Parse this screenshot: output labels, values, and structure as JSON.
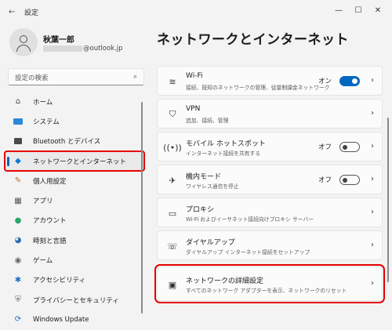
{
  "window": {
    "title": "設定",
    "minimize": "—",
    "maximize": "☐",
    "close": "✕"
  },
  "profile": {
    "name": "秋葉一郎",
    "email_suffix": "@outlook.jp"
  },
  "search": {
    "placeholder": "設定の検索"
  },
  "nav": {
    "items": [
      {
        "label": "ホーム",
        "icon": "home-icon"
      },
      {
        "label": "システム",
        "icon": "system-icon"
      },
      {
        "label": "Bluetooth とデバイス",
        "icon": "bluetooth-icon"
      },
      {
        "label": "ネットワークとインターネット",
        "icon": "wifi-icon",
        "active": true
      },
      {
        "label": "個人用設定",
        "icon": "brush-icon"
      },
      {
        "label": "アプリ",
        "icon": "apps-icon"
      },
      {
        "label": "アカウント",
        "icon": "account-icon"
      },
      {
        "label": "時刻と言語",
        "icon": "clock-globe-icon"
      },
      {
        "label": "ゲーム",
        "icon": "gamepad-icon"
      },
      {
        "label": "アクセシビリティ",
        "icon": "accessibility-icon"
      },
      {
        "label": "プライバシーとセキュリティ",
        "icon": "shield-icon"
      },
      {
        "label": "Windows Update",
        "icon": "update-icon"
      }
    ]
  },
  "main": {
    "title": "ネットワークとインターネット",
    "cards": [
      {
        "title": "Wi-Fi",
        "desc": "接続、既知のネットワークの管理、従量制課金ネットワーク",
        "state": "オン",
        "toggle": "on",
        "icon": "wifi-icon"
      },
      {
        "title": "VPN",
        "desc": "追加、接続、管理",
        "icon": "vpn-shield-icon"
      },
      {
        "title": "モバイル ホットスポット",
        "desc": "インターネット接続を共有する",
        "state": "オフ",
        "toggle": "off",
        "icon": "hotspot-icon"
      },
      {
        "title": "機内モード",
        "desc": "ワイヤレス通信を停止",
        "state": "オフ",
        "toggle": "off",
        "icon": "airplane-icon"
      },
      {
        "title": "プロキシ",
        "desc": "Wi-Fi およびイーサネット接続向けプロキシ サーバー",
        "icon": "proxy-icon"
      },
      {
        "title": "ダイヤルアップ",
        "desc": "ダイヤルアップ インターネット接続をセットアップ",
        "icon": "dialup-icon"
      },
      {
        "title": "ネットワークの詳細設定",
        "desc": "すべてのネットワーク アダプターを表示、ネットワークのリセット",
        "icon": "network-pc-icon",
        "highlight": true
      }
    ]
  }
}
